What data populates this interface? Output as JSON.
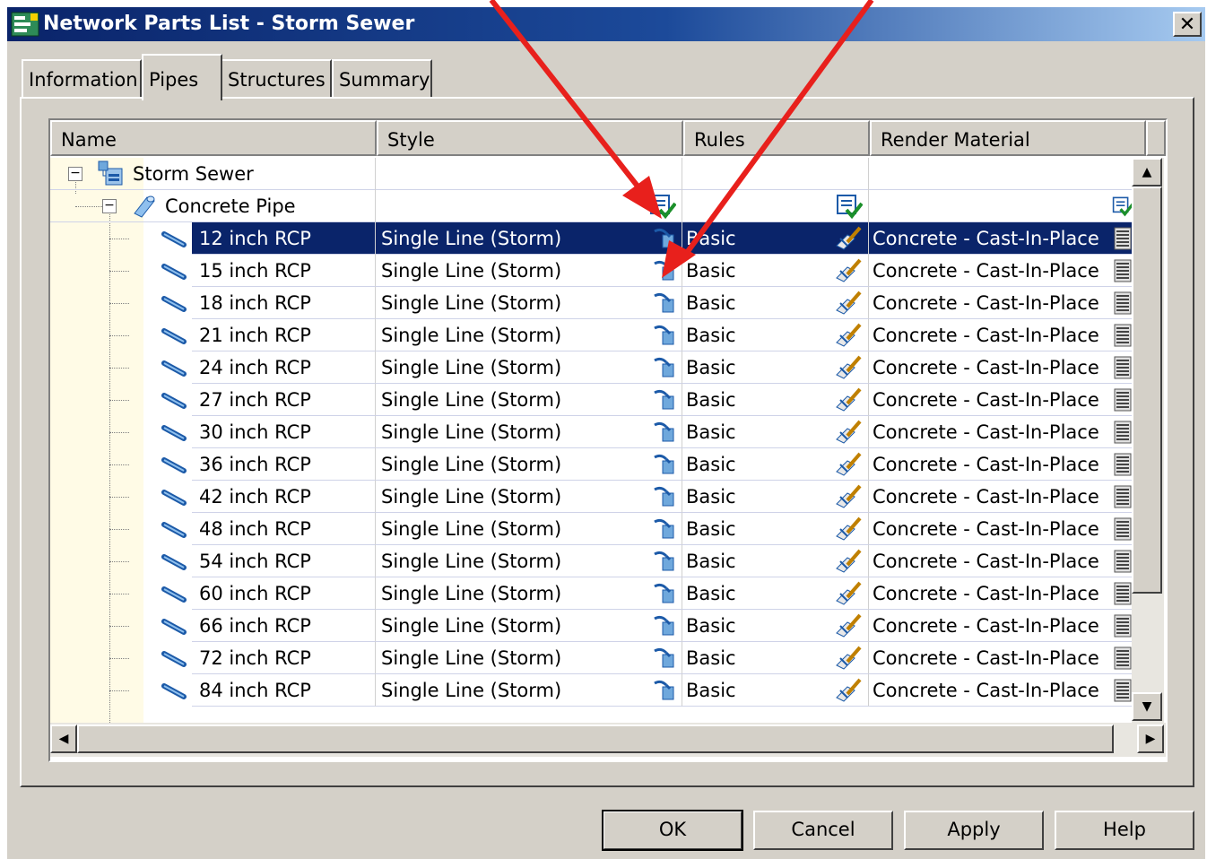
{
  "window": {
    "title": "Network Parts List - Storm Sewer",
    "close_label": "✕"
  },
  "tabs": [
    {
      "label": "Information",
      "active": false
    },
    {
      "label": "Pipes",
      "active": true
    },
    {
      "label": "Structures",
      "active": false
    },
    {
      "label": "Summary",
      "active": false
    }
  ],
  "columns": [
    "Name",
    "Style",
    "Rules",
    "Render Material"
  ],
  "tree": {
    "root": {
      "label": "Storm Sewer",
      "icon": "network-icon",
      "expanded": true
    },
    "family": {
      "label": "Concrete Pipe",
      "icon": "pipe-family-icon",
      "expanded": true
    }
  },
  "rows": [
    {
      "name": "12 inch RCP",
      "style": "Single Line (Storm)",
      "rules": "Basic",
      "material": "Concrete - Cast-In-Place",
      "selected": true
    },
    {
      "name": "15 inch RCP",
      "style": "Single Line (Storm)",
      "rules": "Basic",
      "material": "Concrete - Cast-In-Place"
    },
    {
      "name": "18 inch RCP",
      "style": "Single Line (Storm)",
      "rules": "Basic",
      "material": "Concrete - Cast-In-Place"
    },
    {
      "name": "21 inch RCP",
      "style": "Single Line (Storm)",
      "rules": "Basic",
      "material": "Concrete - Cast-In-Place"
    },
    {
      "name": "24 inch RCP",
      "style": "Single Line (Storm)",
      "rules": "Basic",
      "material": "Concrete - Cast-In-Place"
    },
    {
      "name": "27 inch RCP",
      "style": "Single Line (Storm)",
      "rules": "Basic",
      "material": "Concrete - Cast-In-Place"
    },
    {
      "name": "30 inch RCP",
      "style": "Single Line (Storm)",
      "rules": "Basic",
      "material": "Concrete - Cast-In-Place"
    },
    {
      "name": "36 inch RCP",
      "style": "Single Line (Storm)",
      "rules": "Basic",
      "material": "Concrete - Cast-In-Place"
    },
    {
      "name": "42 inch RCP",
      "style": "Single Line (Storm)",
      "rules": "Basic",
      "material": "Concrete - Cast-In-Place"
    },
    {
      "name": "48 inch RCP",
      "style": "Single Line (Storm)",
      "rules": "Basic",
      "material": "Concrete - Cast-In-Place"
    },
    {
      "name": "54 inch RCP",
      "style": "Single Line (Storm)",
      "rules": "Basic",
      "material": "Concrete - Cast-In-Place"
    },
    {
      "name": "60 inch RCP",
      "style": "Single Line (Storm)",
      "rules": "Basic",
      "material": "Concrete - Cast-In-Place"
    },
    {
      "name": "66 inch RCP",
      "style": "Single Line (Storm)",
      "rules": "Basic",
      "material": "Concrete - Cast-In-Place"
    },
    {
      "name": "72 inch RCP",
      "style": "Single Line (Storm)",
      "rules": "Basic",
      "material": "Concrete - Cast-In-Place"
    },
    {
      "name": "84 inch RCP",
      "style": "Single Line (Storm)",
      "rules": "Basic",
      "material": "Concrete - Cast-In-Place"
    }
  ],
  "buttons": {
    "ok": "OK",
    "cancel": "Cancel",
    "apply": "Apply",
    "help": "Help"
  },
  "colors": {
    "selection": "#0a246a",
    "dialog": "#d4d0c8",
    "annotation_arrow": "#e8201c"
  }
}
